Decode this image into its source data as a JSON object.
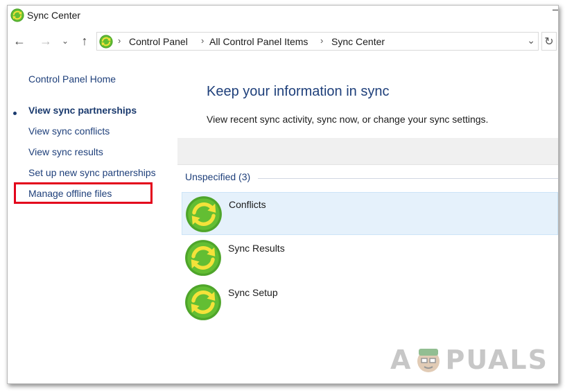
{
  "window": {
    "title": "Sync Center"
  },
  "address": {
    "crumbs": [
      "Control Panel",
      "All Control Panel Items",
      "Sync Center"
    ]
  },
  "sidebar": {
    "home": "Control Panel Home",
    "items": [
      {
        "label": "View sync partnerships",
        "active": true
      },
      {
        "label": "View sync conflicts"
      },
      {
        "label": "View sync results"
      },
      {
        "label": "Set up new sync partnerships"
      },
      {
        "label": "Manage offline files",
        "highlighted": true
      }
    ]
  },
  "main": {
    "heading": "Keep your information in sync",
    "subtext": "View recent sync activity, sync now, or change your sync settings.",
    "group": {
      "label": "Unspecified (3)"
    },
    "items": [
      {
        "label": "Conflicts",
        "selected": true
      },
      {
        "label": "Sync Results"
      },
      {
        "label": "Sync Setup"
      }
    ]
  },
  "watermark": {
    "left": "A",
    "right": "PUALS"
  },
  "colors": {
    "link": "#1e3f7a",
    "highlight": "#e3001b",
    "selection": "#e5f1fb",
    "sync_icon_green": "#5bb52e",
    "sync_arrow_yellow": "#f4e23a"
  }
}
